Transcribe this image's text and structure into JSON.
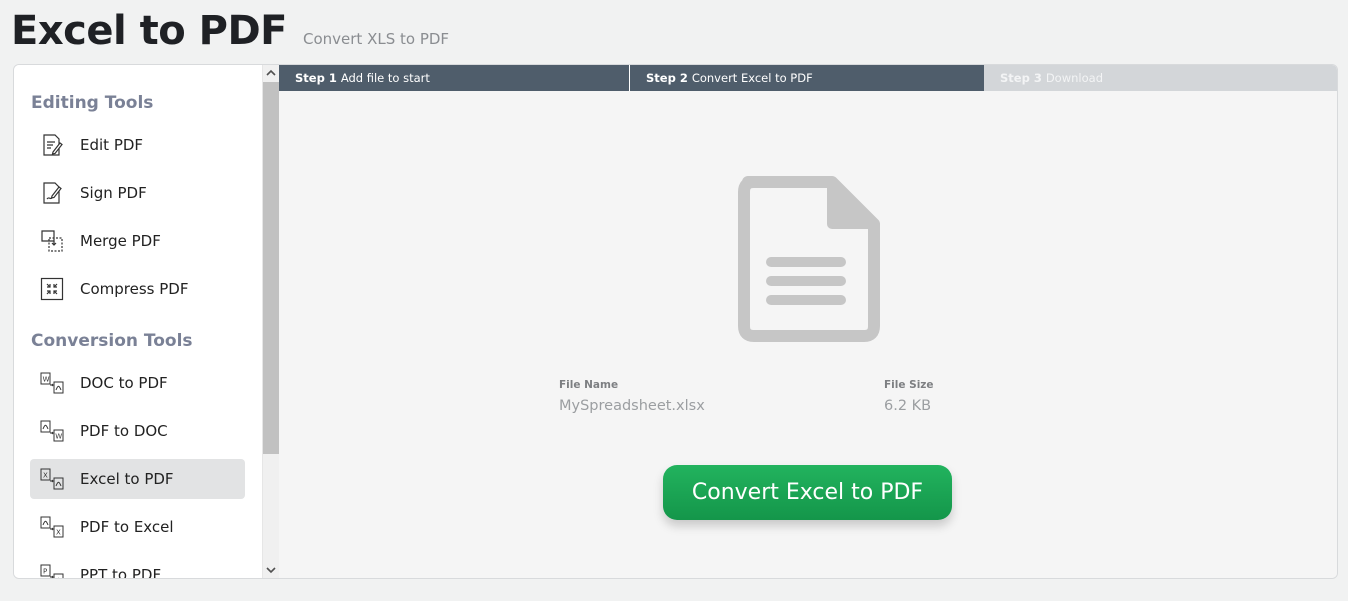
{
  "header": {
    "title": "Excel to PDF",
    "subtitle": "Convert XLS to PDF"
  },
  "sidebar": {
    "sections": [
      {
        "title": "Editing Tools",
        "items": [
          {
            "label": "Edit PDF",
            "icon": "edit-pdf-icon"
          },
          {
            "label": "Sign PDF",
            "icon": "sign-pdf-icon"
          },
          {
            "label": "Merge PDF",
            "icon": "merge-pdf-icon"
          },
          {
            "label": "Compress PDF",
            "icon": "compress-pdf-icon"
          }
        ]
      },
      {
        "title": "Conversion Tools",
        "items": [
          {
            "label": "DOC to PDF",
            "icon": "doc-to-pdf-icon"
          },
          {
            "label": "PDF to DOC",
            "icon": "pdf-to-doc-icon"
          },
          {
            "label": "Excel to PDF",
            "icon": "excel-to-pdf-icon",
            "active": true
          },
          {
            "label": "PDF to Excel",
            "icon": "pdf-to-excel-icon"
          },
          {
            "label": "PPT to PDF",
            "icon": "ppt-to-pdf-icon"
          }
        ]
      }
    ]
  },
  "steps": [
    {
      "number": "Step 1",
      "label": "Add file to start",
      "state": "complete"
    },
    {
      "number": "Step 2",
      "label": "Convert Excel to PDF",
      "state": "current"
    },
    {
      "number": "Step 3",
      "label": "Download",
      "state": "pending"
    }
  ],
  "file": {
    "name_label": "File Name",
    "name": "MySpreadsheet.xlsx",
    "size_label": "File Size",
    "size": "6.2 KB"
  },
  "convert_button": {
    "label": "Convert Excel to PDF"
  },
  "colors": {
    "step_active": "#4f5d6b",
    "step_pending": "#d3d6d9",
    "button_green": "#1aa554",
    "section_title": "#7a8196"
  }
}
